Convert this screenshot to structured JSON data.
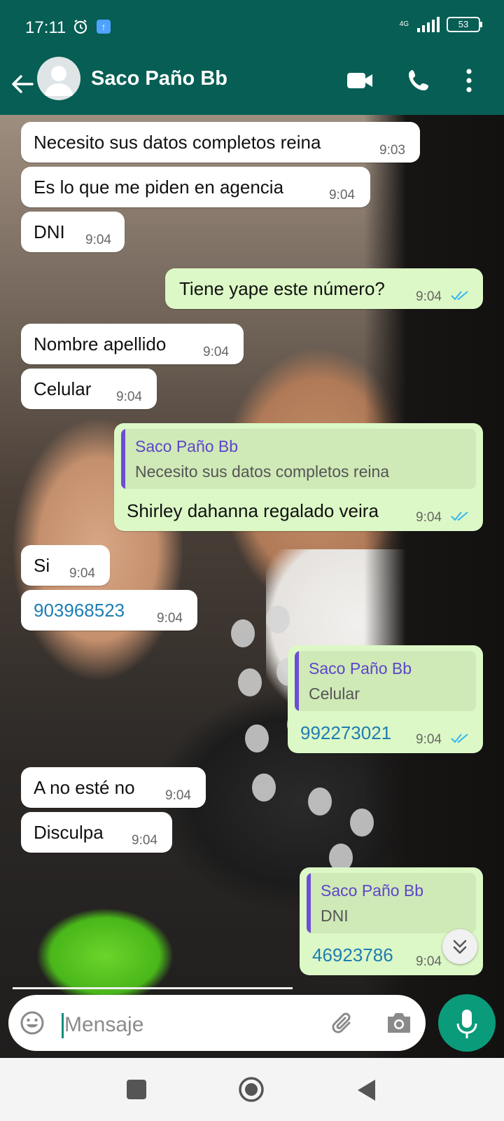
{
  "status_bar": {
    "time": "17:11",
    "network": "4G",
    "battery": "53"
  },
  "header": {
    "contact_name": "Saco Paño Bb"
  },
  "messages": [
    {
      "text": "Necesito sus datos completos reina",
      "time": "9:03"
    },
    {
      "text": "Es lo que me piden en agencia",
      "time": "9:04"
    },
    {
      "text": "DNI",
      "time": "9:04"
    },
    {
      "text": "Tiene yape este número?",
      "time": "9:04"
    },
    {
      "text": "Nombre apellido",
      "time": "9:04"
    },
    {
      "text": "Celular",
      "time": "9:04"
    },
    {
      "quote_name": "Saco Paño Bb",
      "quote_text": "Necesito sus datos completos reina",
      "text": "Shirley dahanna regalado veira",
      "time": "9:04"
    },
    {
      "text": "Si",
      "time": "9:04"
    },
    {
      "text": "903968523",
      "time": "9:04"
    },
    {
      "quote_name": "Saco Paño Bb",
      "quote_text": "Celular",
      "text": "992273021",
      "time": "9:04"
    },
    {
      "text": "A no esté no",
      "time": "9:04"
    },
    {
      "text": "Disculpa",
      "time": "9:04"
    },
    {
      "quote_name": "Saco Paño Bb",
      "quote_text": "DNI",
      "text": "46923786",
      "time": "9:04"
    }
  ],
  "composer": {
    "placeholder": "Mensaje"
  },
  "colors": {
    "header": "#075e54",
    "outgoing_bubble": "#dcf8c6",
    "incoming_bubble": "#ffffff",
    "read_ticks": "#34b7f1",
    "mic_button": "#0a9b7a",
    "quote_accent": "#6c4ed4"
  },
  "icons": [
    "alarm-icon",
    "upload-notification-icon",
    "signal-icon",
    "battery-icon",
    "back-arrow-icon",
    "avatar-icon",
    "video-call-icon",
    "phone-call-icon",
    "more-options-icon",
    "double-check-icon",
    "scroll-down-icon",
    "emoji-icon",
    "attach-icon",
    "camera-icon",
    "mic-icon",
    "recents-icon",
    "home-icon",
    "back-icon"
  ]
}
